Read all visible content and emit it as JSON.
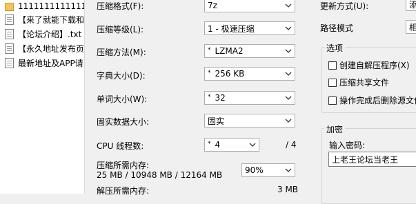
{
  "file_list": [
    {
      "name": "11111111111111",
      "icon": "folder-icon"
    },
    {
      "name": "【来了就能下载和",
      "icon": "text-file-icon"
    },
    {
      "name": "【论坛介绍】.txt",
      "icon": "text-file-icon"
    },
    {
      "name": "【永久地址发布页",
      "icon": "text-file-icon"
    },
    {
      "name": "最新地址及APP请",
      "icon": "text-file-icon"
    }
  ],
  "left_column": {
    "format_label": "压缩格式(F):",
    "format_value": "7z",
    "level_label": "压缩等级(L):",
    "level_value": "1 - 极速压缩",
    "method_label": "压缩方法(M):",
    "method_value": "LZMA2",
    "dict_label": "字典大小(D):",
    "dict_value": "256 KB",
    "word_label": "单词大小(W):",
    "word_value": "32",
    "solid_label": "固实数据大小:",
    "solid_value": "固实",
    "threads_label": "CPU 线程数:",
    "threads_value": "4",
    "threads_total": "/ 4",
    "mem_compress_label": "压缩所需内存:",
    "mem_compress_value": "25 MB / 10948 MB / 12164 MB",
    "mem_percent": "90%",
    "mem_decompress_label": "解压所需内存:",
    "mem_decompress_value": "3 MB"
  },
  "right_column": {
    "update_label": "更新方式(U):",
    "update_value": "添",
    "path_label": "路径模式",
    "path_value": "相",
    "options_title": "选项",
    "options": [
      {
        "label": "创建自解压程序(X)",
        "checked": false
      },
      {
        "label": "压缩共享文件",
        "checked": false
      },
      {
        "label": "操作完成后删除源文件",
        "checked": false
      }
    ],
    "encrypt_title": "加密",
    "password_label": "输入密码:",
    "password_value": "上老王论坛当老王"
  }
}
